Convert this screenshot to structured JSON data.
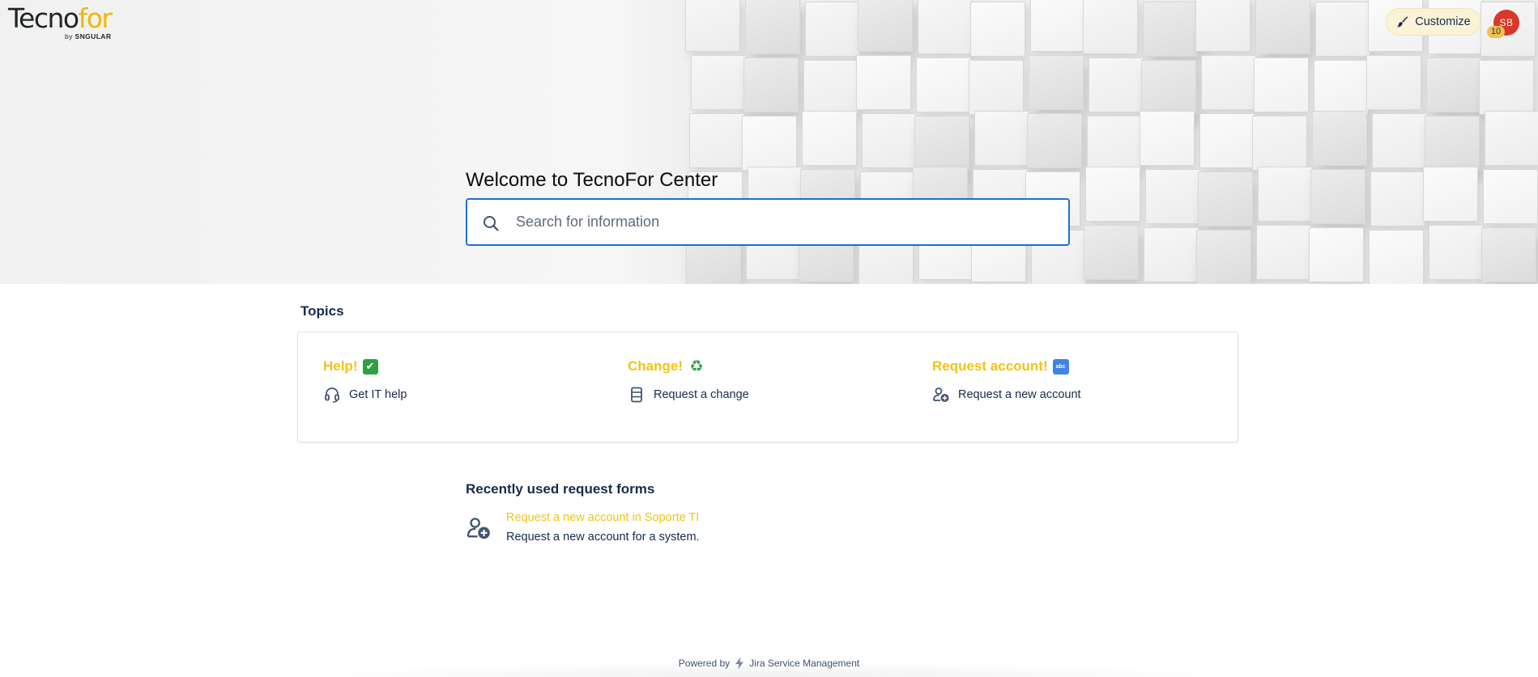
{
  "brand": {
    "logo_main_a": "Tecno",
    "logo_main_b": "for",
    "logo_sub_by": "by",
    "logo_sub_name": "SNGULAR",
    "accent_color": "#f2b705"
  },
  "header": {
    "customize_label": "Customize",
    "customize_icon": "paintbrush-icon",
    "avatar_initials": "SB",
    "avatar_color": "#d9372b",
    "notification_count": "10"
  },
  "hero": {
    "welcome_title": "Welcome to TecnoFor Center",
    "search_placeholder": "Search for information",
    "search_value": "",
    "search_icon": "search-icon"
  },
  "topics": {
    "heading": "Topics",
    "title_color": "#f2c314",
    "items": [
      {
        "title": "Help!",
        "emoji": "✔",
        "link_label": "Get IT help",
        "link_icon": "headset-icon"
      },
      {
        "title": "Change!",
        "emoji": "♻",
        "link_label": "Request a change",
        "link_icon": "document-icon"
      },
      {
        "title": "Request account!",
        "emoji": "abc",
        "link_label": "Request a new account",
        "link_icon": "add-user-icon"
      }
    ]
  },
  "recent": {
    "heading": "Recently used request forms",
    "items": [
      {
        "link": "Request a new account in Soporte TI",
        "description": "Request a new account for a system.",
        "icon": "add-user-icon"
      }
    ]
  },
  "footer": {
    "powered_by": "Powered by",
    "product": "Jira Service Management",
    "product_icon": "jira-bolt-icon"
  }
}
